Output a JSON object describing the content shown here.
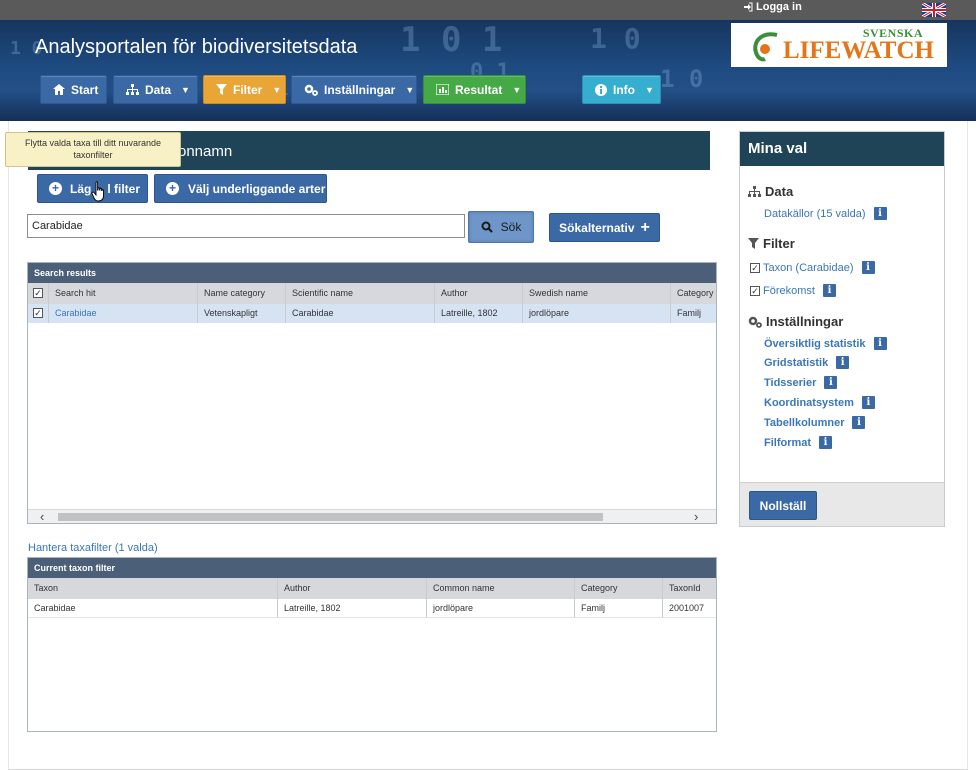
{
  "topbar": {
    "login_label": "Logga in"
  },
  "header": {
    "title": "Analysportalen för biodiversitetsdata",
    "logo": {
      "line1": "SVENSKA",
      "line2": "LIFEWATCH"
    },
    "nav": [
      {
        "label": "Start",
        "icon": "home-icon",
        "color": "#3b69a6"
      },
      {
        "label": "Data",
        "icon": "sitemap-icon",
        "color": "#3b69a6"
      },
      {
        "label": "Filter",
        "icon": "filter-icon",
        "color": "#e9a535"
      },
      {
        "label": "Inställningar",
        "icon": "cogs-icon",
        "color": "#3b69a6"
      },
      {
        "label": "Resultat",
        "icon": "bar-chart-icon",
        "color": "#45a945"
      },
      {
        "label": "Info",
        "icon": "info-circle-icon",
        "color": "#36aed0"
      }
    ]
  },
  "taxon_panel": {
    "title_visible": "onnamn",
    "tooltip": "Flytta valda taxa till ditt nuvarande taxonfilter",
    "add_button": "Lägg till filter",
    "add_button_visible_start": "Läg",
    "add_button_visible_end": "l filter",
    "underlying_button": "Välj underliggande arter",
    "search_value": "Carabidae",
    "search_button": "Sök",
    "search_options_button": "Sökalternativ"
  },
  "search_results": {
    "title": "Search results",
    "columns": [
      "Search hit",
      "Name category",
      "Scientific name",
      "Author",
      "Swedish name",
      "Category"
    ],
    "rows": [
      {
        "hit": "Carabidae",
        "name_category": "Vetenskapligt",
        "scientific_name": "Carabidae",
        "author": "Latreille, 1802",
        "swedish_name": "jordlöpare",
        "category": "Familj",
        "checked": "✓"
      }
    ],
    "header_check": "✓"
  },
  "manage_link": "Hantera taxafilter (1 valda)",
  "current_filter": {
    "title": "Current taxon filter",
    "columns": [
      "Taxon",
      "Author",
      "Common name",
      "Category",
      "TaxonId"
    ],
    "rows": [
      {
        "taxon": "Carabidae",
        "author": "Latreille, 1802",
        "common_name": "jordlöpare",
        "category": "Familj",
        "taxon_id": "2001007"
      }
    ]
  },
  "mina_val": {
    "title": "Mina val",
    "data_section": "Data",
    "data_items": [
      "Datakällor (15 valda)"
    ],
    "filter_section": "Filter",
    "filter_items": [
      "Taxon (Carabidae)",
      "Förekomst"
    ],
    "settings_section": "Inställningar",
    "settings_items": [
      "Översiktlig statistik",
      "Gridstatistik",
      "Tidsserier",
      "Koordinatsystem",
      "Tabellkolumner",
      "Filformat"
    ],
    "info_glyph": "i",
    "check_glyph": "✓",
    "reset_button": "Nollställ"
  }
}
